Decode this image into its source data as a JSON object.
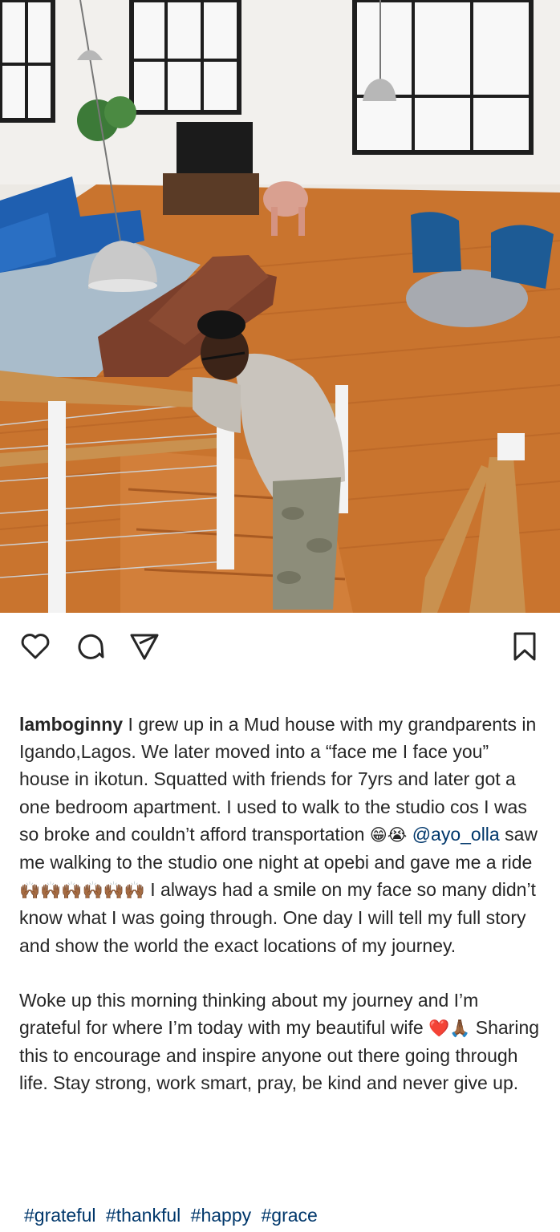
{
  "post": {
    "image_alt": "Man leaning on staircase railing overlooking a bright loft living room",
    "colors": {
      "text": "#262626",
      "link": "#00376b",
      "floor": "#c9742e",
      "sofa_blue": "#1f5fb0",
      "leather": "#7b3f2b"
    },
    "actions": {
      "like_icon": "heart-outline-icon",
      "comment_icon": "comment-bubble-icon",
      "share_icon": "paper-plane-icon",
      "save_icon": "bookmark-icon"
    },
    "caption": {
      "username": "lamboginny",
      "part1": " I grew up in a Mud house with my grandparents in Igando,Lagos. We later moved into a “face me I face you” house in ikotun. Squatted with friends for 7yrs and later got a one bedroom apartment. I used to walk to the studio cos I was so broke and couldn’t afford transportation ",
      "emoji1": "😁😭",
      "mention": "@ayo_olla",
      "part2": " saw me walking to the studio one night at opebi and gave me a ride ",
      "emoji2": "🙌🏾🙌🏾🙌🏾🙌🏾🙌🏾🙌🏾",
      "part3": " I always had a smile on my face so many didn’t know what I was going through. One day I will tell my full story and show the world the exact locations of my journey.",
      "para2_text": "Woke up this morning thinking about my journey and I’m grateful for where I’m today with my beautiful wife ",
      "emoji3": "❤️🙏🏾",
      "para2_end": " Sharing this to encourage and inspire anyone out there going through life. Stay strong, work smart, pray, be kind and never give up."
    },
    "hashtags": [
      "#grateful",
      "#thankful",
      "#happy",
      "#grace"
    ]
  }
}
